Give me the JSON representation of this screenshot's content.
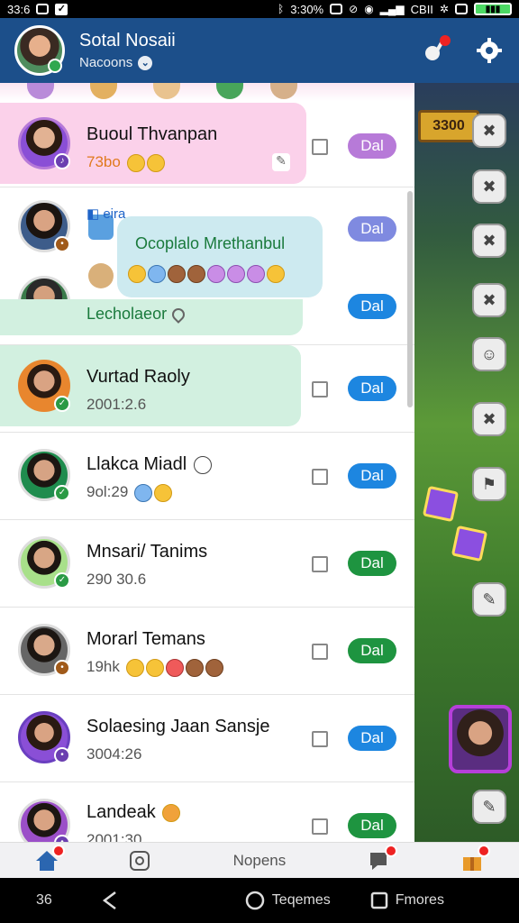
{
  "status_bar": {
    "left_text": "33:6",
    "time": "3:30%",
    "net_text": "CBII"
  },
  "header": {
    "title": "Sotal Nosaii",
    "subtitle": "Nacoons",
    "settings_icon": "gear-icon",
    "notify_icon": "bell-icon"
  },
  "chats": [
    {
      "name": "Buoul Thvanpan",
      "sub": "73bo",
      "sub_color": "#e07a1f",
      "action": "Dal",
      "action_color": "purple",
      "highlight": "#fbd1ea"
    },
    {
      "group_tag": "eira",
      "group_title": "Ocoplalo Mrethanbul",
      "action": "Dal",
      "action_color": "lav"
    },
    {
      "name": "Lecholaeor",
      "name_color": "#1a7a3c",
      "action": "Dal",
      "action_color": "blue",
      "highlight": "#d2f0e0"
    },
    {
      "name": "Vurtad Raoly",
      "sub": "2001:2.6",
      "action": "Dal",
      "action_color": "blue",
      "highlight": "#d2f0e0"
    },
    {
      "name": "Llakca Miadl",
      "sub": "9ol:29",
      "action": "Dal",
      "action_color": "blue"
    },
    {
      "name": "Mnsari/ Tanims",
      "sub": "290 30.6",
      "action": "Dal",
      "action_color": "green"
    },
    {
      "name": "Morarl Temans",
      "sub": "19hk",
      "action": "Dal",
      "action_color": "green"
    },
    {
      "name": "Solaesing Jaan Sansje",
      "sub": "3004:26",
      "action": "Dal",
      "action_color": "blue"
    },
    {
      "name": "Landeak",
      "sub": "2001:30",
      "action": "Dal",
      "action_color": "green"
    }
  ],
  "game": {
    "tile_label": "3300"
  },
  "bottom_nav": {
    "center_label": "Nopens"
  },
  "system_nav": {
    "left": "36",
    "home_label": "Teqemes",
    "recents_label": "Fmores"
  }
}
